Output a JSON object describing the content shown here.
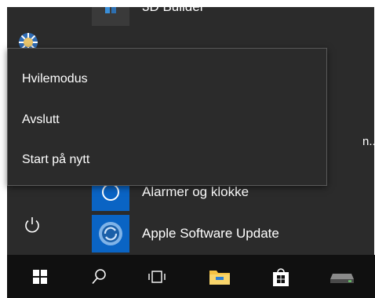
{
  "start_menu": {
    "apps": [
      {
        "label": "3D Builder",
        "tile_color": "#3a3a3a"
      },
      {
        "label": "Alarmer og klokke",
        "tile_color": "#0a64c4"
      },
      {
        "label": "Apple Software Update",
        "tile_color": "#0a64c4"
      }
    ],
    "group_expander_label": "n..."
  },
  "power_menu": {
    "items": [
      {
        "label": "Hvilemodus"
      },
      {
        "label": "Avslutt"
      },
      {
        "label": "Start på nytt"
      }
    ]
  },
  "taskbar": {
    "icons": [
      "windows-icon",
      "search-icon",
      "task-view-icon",
      "file-explorer-icon",
      "store-icon",
      "drive-icon"
    ]
  },
  "colors": {
    "menu_background": "#2b2b2b",
    "taskbar_background": "#101010",
    "accent": "#0a64c4"
  }
}
